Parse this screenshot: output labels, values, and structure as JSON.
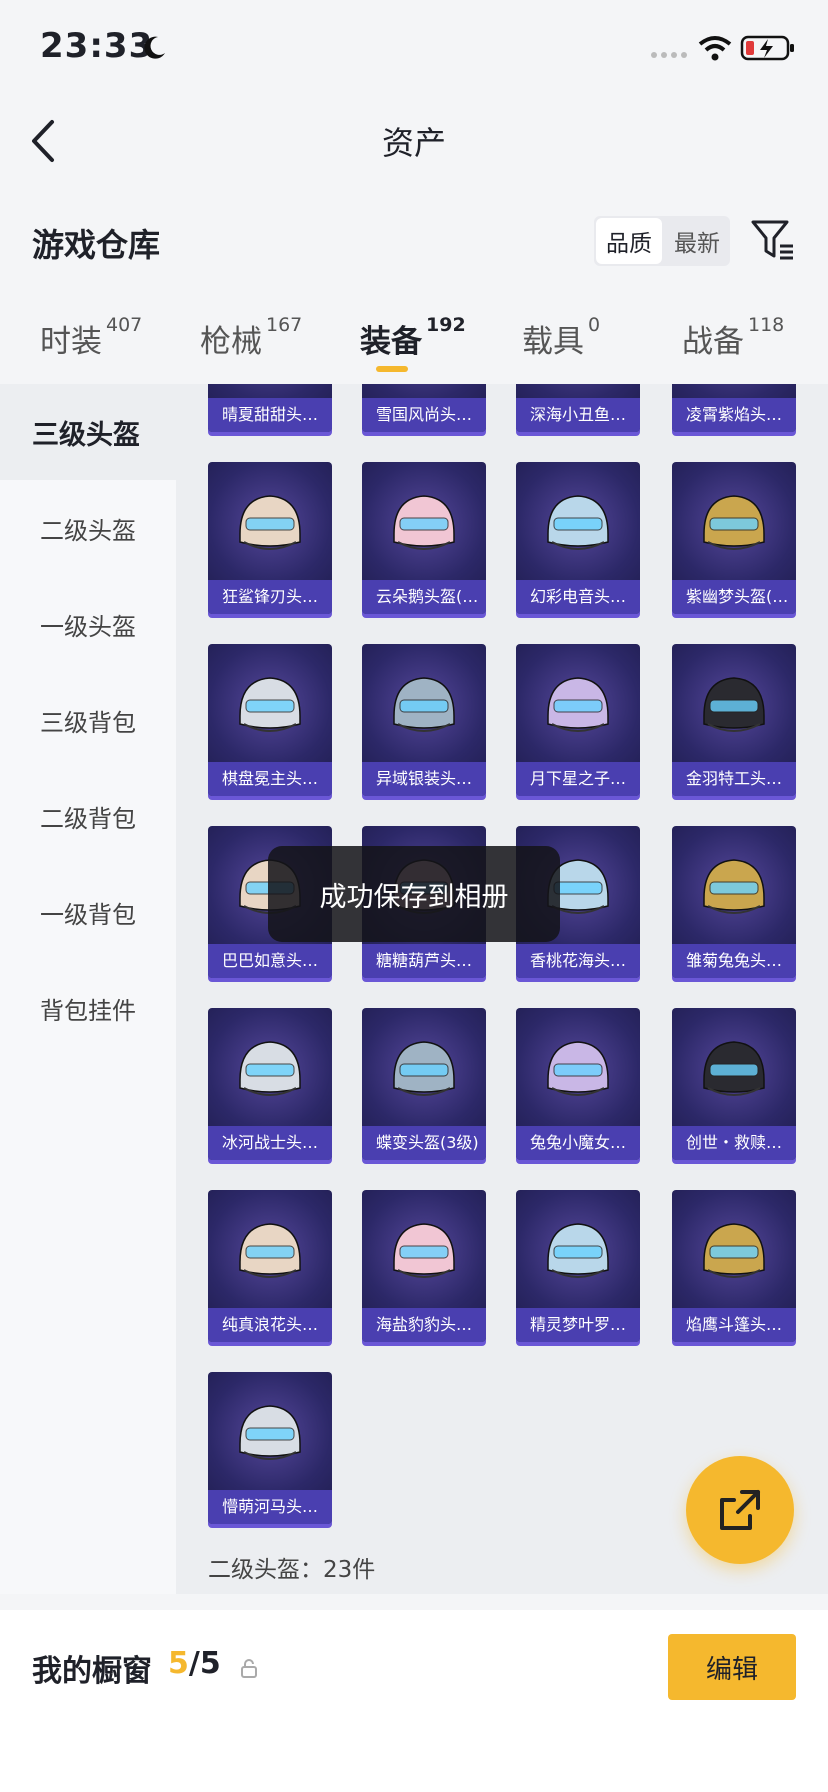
{
  "status_bar": {
    "time": "23:33"
  },
  "nav": {
    "title": "资产"
  },
  "section": {
    "title": "游戏仓库"
  },
  "sort": {
    "options": [
      "品质",
      "最新"
    ],
    "active": 0
  },
  "tabs": [
    {
      "label": "时装",
      "count": "407"
    },
    {
      "label": "枪械",
      "count": "167"
    },
    {
      "label": "装备",
      "count": "192"
    },
    {
      "label": "载具",
      "count": "0"
    },
    {
      "label": "战备",
      "count": "118"
    }
  ],
  "active_tab": 2,
  "sidebar": {
    "items": [
      "三级头盔",
      "二级头盔",
      "一级头盔",
      "三级背包",
      "二级背包",
      "一级背包",
      "背包挂件"
    ],
    "active": 0
  },
  "grid": {
    "items": [
      "晴夏甜甜头…",
      "雪国风尚头…",
      "深海小丑鱼…",
      "凌霄紫焰头…",
      "狂鲨锋刃头…",
      "云朵鹅头盔(…",
      "幻彩电音头…",
      "紫幽梦头盔(…",
      "棋盘冕主头…",
      "异域银装头…",
      "月下星之子…",
      "金羽特工头…",
      "巴巴如意头…",
      "糖糖葫芦头…",
      "香桃花海头…",
      "雏菊兔兔头…",
      "冰河战士头…",
      "蝶变头盔(3级)",
      "兔兔小魔女…",
      "创世・救赎…",
      "纯真浪花头…",
      "海盐豹豹头…",
      "精灵梦叶罗…",
      "焰鹰斗篷头…",
      "懵萌河马头…"
    ],
    "count_label": "二级头盔：23件"
  },
  "toast": {
    "text": "成功保存到相册"
  },
  "bottom_bar": {
    "label": "我的橱窗",
    "current": "5",
    "total": "/5",
    "edit_label": "编辑"
  },
  "colors": {
    "accent": "#f5b82e",
    "card_bg": "#2c2868",
    "card_label": "#4a3fb0"
  }
}
